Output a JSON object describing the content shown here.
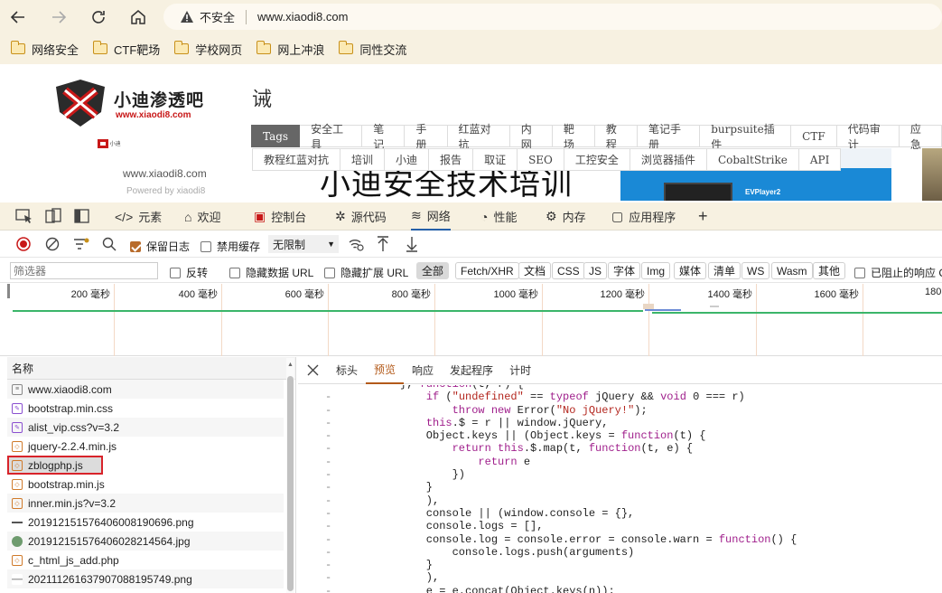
{
  "browser": {
    "security_label": "不安全",
    "url": "www.xiaodi8.com",
    "bookmarks": [
      "网络安全",
      "CTF靶场",
      "学校网页",
      "网上冲浪",
      "同性交流"
    ]
  },
  "page": {
    "logo_brand": "小迪渗透吧",
    "logo_url": "www.xiaodi8.com",
    "badge_text": "小迪",
    "site_url": "www.xiaodi8.com",
    "powered_by": "Powered by xiaodi8",
    "heading_char": "诫",
    "nav_row1": [
      "Tags",
      "安全工具",
      "笔记",
      "手册",
      "红蓝对抗",
      "内网",
      "靶场",
      "教程",
      "笔记手册",
      "burpsuite插件",
      "CTF",
      "代码审计",
      "应急"
    ],
    "nav_row2": [
      "教程红蓝对抗",
      "培训",
      "小迪",
      "报告",
      "取证",
      "SEO",
      "工控安全",
      "浏览器插件",
      "CobaltStrike",
      "API"
    ],
    "banner_text": "小迪安全技术培训",
    "player_label": "EVPlayer2"
  },
  "devtools": {
    "tabs": [
      "元素",
      "欢迎",
      "控制台",
      "源代码",
      "网络",
      "性能",
      "内存",
      "应用程序"
    ],
    "active_tab": "网络",
    "toolbar": {
      "preserve_log": "保留日志",
      "disable_cache": "禁用缓存",
      "throttle": "无限制"
    },
    "filter": {
      "placeholder": "筛选器",
      "invert": "反转",
      "hide_data_url": "隐藏数据 URL",
      "hide_ext_url": "隐藏扩展 URL",
      "types": [
        "全部",
        "Fetch/XHR",
        "文档",
        "CSS",
        "JS",
        "字体",
        "Img",
        "媒体",
        "清单",
        "WS",
        "Wasm",
        "其他"
      ],
      "blocked": "已阻止的响应 C"
    },
    "timeline_ticks": [
      "200 毫秒",
      "400 毫秒",
      "600 毫秒",
      "800 毫秒",
      "1000 毫秒",
      "1200 毫秒",
      "1400 毫秒",
      "1600 毫秒",
      "180"
    ],
    "requests_header": "名称",
    "requests": [
      {
        "name": "www.xiaodi8.com",
        "icon": "document-icon"
      },
      {
        "name": "bootstrap.min.css",
        "icon": "stylesheet-icon"
      },
      {
        "name": "alist_vip.css?v=3.2",
        "icon": "stylesheet-icon"
      },
      {
        "name": "jquery-2.2.4.min.js",
        "icon": "script-icon"
      },
      {
        "name": "zblogphp.js",
        "icon": "script-icon"
      },
      {
        "name": "bootstrap.min.js",
        "icon": "script-icon"
      },
      {
        "name": "inner.min.js?v=3.2",
        "icon": "script-icon"
      },
      {
        "name": "20191215157640600819069​6.png",
        "icon": "image-icon"
      },
      {
        "name": "20191215157640602821456​4.jpg",
        "icon": "image-icon"
      },
      {
        "name": "c_html_js_add.php",
        "icon": "script-icon"
      },
      {
        "name": "20211126163790708819574​9.png",
        "icon": "image-icon"
      }
    ],
    "selected_request": "zblogphp.js",
    "detail_tabs": [
      "标头",
      "预览",
      "响应",
      "发起程序",
      "计时"
    ],
    "active_detail_tab": "预览",
    "code_lines": [
      "}, function(t, r) {",
      "    if (\"undefined\" == typeof jQuery && void 0 === r)",
      "        throw new Error(\"No jQuery!\");",
      "    this.$ = r || window.jQuery,",
      "    Object.keys || (Object.keys = function(t) {",
      "        return this.$.map(t, function(t, e) {",
      "            return e",
      "        })",
      "    }",
      "    ),",
      "    console || (window.console = {},",
      "    console.logs = [],",
      "    console.log = console.error = console.warn = function() {",
      "        console.logs.push(arguments)",
      "    }",
      "    ),",
      "    e = e.concat(Object.keys(n));"
    ]
  }
}
